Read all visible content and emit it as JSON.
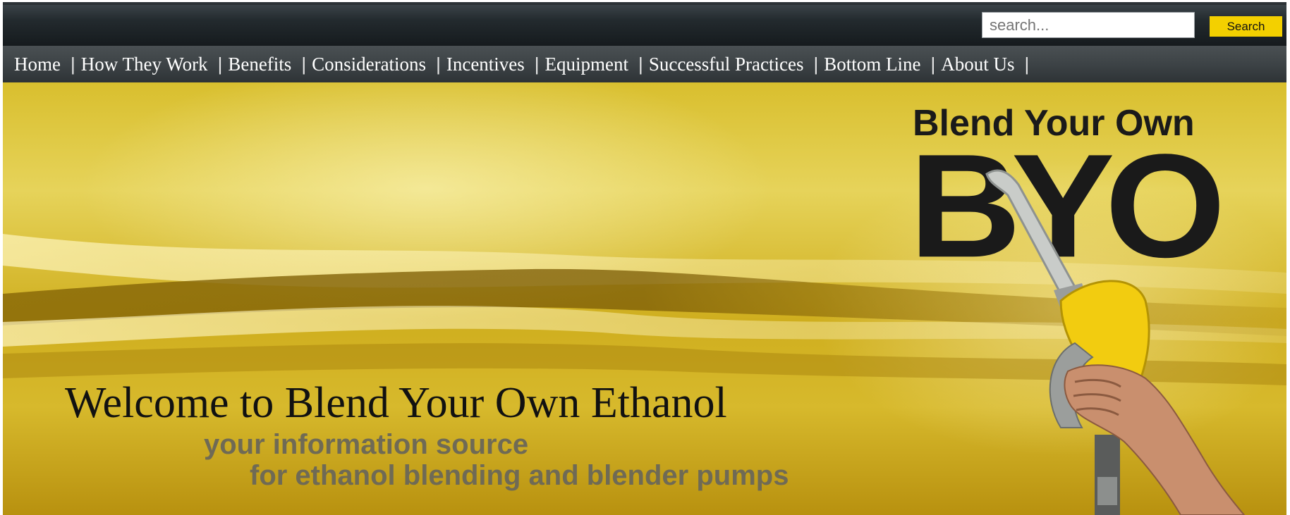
{
  "search": {
    "placeholder": "search...",
    "button_label": "Search"
  },
  "nav": {
    "items": [
      "Home",
      "How They Work",
      "Benefits",
      "Considerations",
      "Incentives",
      "Equipment",
      "Successful Practices",
      "Bottom Line",
      "About Us"
    ],
    "separator": "|"
  },
  "banner": {
    "title": "Welcome to Blend Your Own Ethanol",
    "tagline_line1": "your information source",
    "tagline_line2": "for ethanol blending and blender pumps",
    "logo_headline": "Blend Your Own",
    "logo_mark": "BYO"
  },
  "colors": {
    "accent": "#f3d000",
    "header_dark": "#1b2124",
    "banner_gold": "#d4b42a"
  },
  "icons": {
    "pump": "fuel-nozzle-hand-image"
  }
}
